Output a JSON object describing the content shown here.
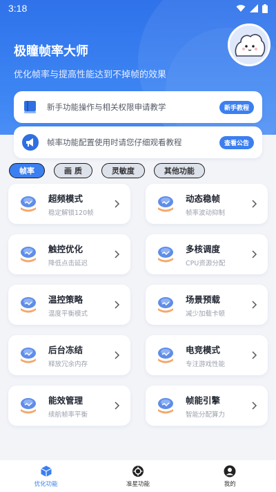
{
  "status_bar": {
    "time": "3:18"
  },
  "header": {
    "title": "极瞳帧率大师",
    "subtitle": "优化帧率与提高性能达到不掉帧的效果"
  },
  "notices": [
    {
      "icon": "book-icon",
      "text": "新手功能操作与相关权限申请教学",
      "button": "新手教程"
    },
    {
      "icon": "megaphone-icon",
      "text": "帧率功能配置使用时请您仔细观看教程",
      "button": "查看公告"
    }
  ],
  "tabs": [
    {
      "label": "帧率",
      "active": true
    },
    {
      "label": "画 质",
      "active": false
    },
    {
      "label": "灵敏度",
      "active": false
    },
    {
      "label": "其他功能",
      "active": false
    }
  ],
  "features": [
    {
      "title": "超频模式",
      "subtitle": "稳定解锁120帧"
    },
    {
      "title": "动态稳帧",
      "subtitle": "帧率波动抑制"
    },
    {
      "title": "触控优化",
      "subtitle": "降低点击延迟"
    },
    {
      "title": "多核调度",
      "subtitle": "CPU资源分配"
    },
    {
      "title": "温控策略",
      "subtitle": "温度平衡模式"
    },
    {
      "title": "场景预载",
      "subtitle": "减少加载卡顿"
    },
    {
      "title": "后台冻结",
      "subtitle": "释放冗余内存"
    },
    {
      "title": "电竞模式",
      "subtitle": "专注游戏性能"
    },
    {
      "title": "能效管理",
      "subtitle": "续航帧率平衡"
    },
    {
      "title": "帧能引擎",
      "subtitle": "智能分配算力"
    }
  ],
  "bottom_nav": [
    {
      "label": "优化功能",
      "icon": "cube-icon",
      "active": true
    },
    {
      "label": "准星功能",
      "icon": "crosshair-icon",
      "active": false
    },
    {
      "label": "我的",
      "icon": "profile-icon",
      "active": false
    }
  ],
  "colors": {
    "primary": "#3b7ff0",
    "header_top": "#2f72ea",
    "background": "#f3f4f8"
  }
}
